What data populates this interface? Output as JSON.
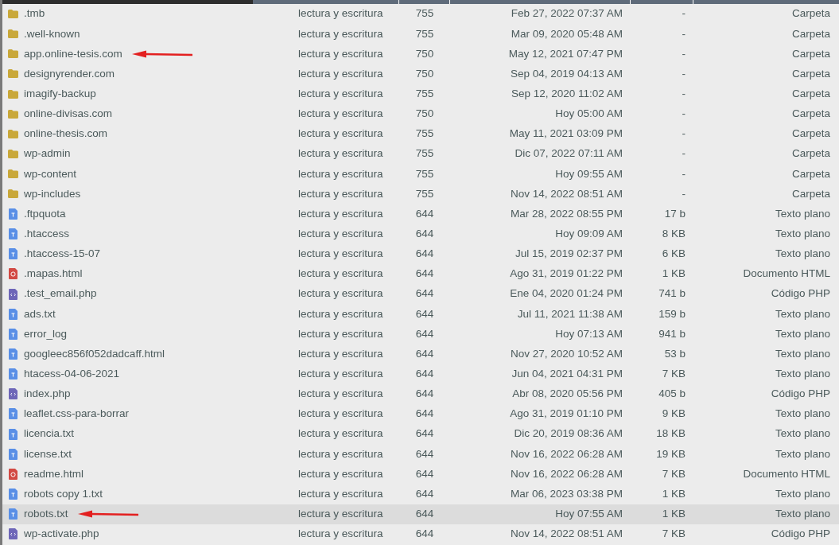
{
  "rows": [
    {
      "kind": "folder",
      "name": ".tmb",
      "permissions": "lectura y escritura",
      "mode": "755",
      "modified": "Feb 27, 2022 07:37 AM",
      "size": "-",
      "type": "Carpeta",
      "selected": false,
      "arrow": false
    },
    {
      "kind": "folder",
      "name": ".well-known",
      "permissions": "lectura y escritura",
      "mode": "755",
      "modified": "Mar 09, 2020 05:48 AM",
      "size": "-",
      "type": "Carpeta",
      "selected": false,
      "arrow": false
    },
    {
      "kind": "folder",
      "name": "app.online-tesis.com",
      "permissions": "lectura y escritura",
      "mode": "750",
      "modified": "May 12, 2021 07:47 PM",
      "size": "-",
      "type": "Carpeta",
      "selected": false,
      "arrow": true
    },
    {
      "kind": "folder",
      "name": "designyrender.com",
      "permissions": "lectura y escritura",
      "mode": "750",
      "modified": "Sep 04, 2019 04:13 AM",
      "size": "-",
      "type": "Carpeta",
      "selected": false,
      "arrow": false
    },
    {
      "kind": "folder",
      "name": "imagify-backup",
      "permissions": "lectura y escritura",
      "mode": "755",
      "modified": "Sep 12, 2020 11:02 AM",
      "size": "-",
      "type": "Carpeta",
      "selected": false,
      "arrow": false
    },
    {
      "kind": "folder",
      "name": "online-divisas.com",
      "permissions": "lectura y escritura",
      "mode": "750",
      "modified": "Hoy 05:00 AM",
      "size": "-",
      "type": "Carpeta",
      "selected": false,
      "arrow": false
    },
    {
      "kind": "folder",
      "name": "online-thesis.com",
      "permissions": "lectura y escritura",
      "mode": "755",
      "modified": "May 11, 2021 03:09 PM",
      "size": "-",
      "type": "Carpeta",
      "selected": false,
      "arrow": false
    },
    {
      "kind": "folder",
      "name": "wp-admin",
      "permissions": "lectura y escritura",
      "mode": "755",
      "modified": "Dic 07, 2022 07:11 AM",
      "size": "-",
      "type": "Carpeta",
      "selected": false,
      "arrow": false
    },
    {
      "kind": "folder",
      "name": "wp-content",
      "permissions": "lectura y escritura",
      "mode": "755",
      "modified": "Hoy 09:55 AM",
      "size": "-",
      "type": "Carpeta",
      "selected": false,
      "arrow": false
    },
    {
      "kind": "folder",
      "name": "wp-includes",
      "permissions": "lectura y escritura",
      "mode": "755",
      "modified": "Nov 14, 2022 08:51 AM",
      "size": "-",
      "type": "Carpeta",
      "selected": false,
      "arrow": false
    },
    {
      "kind": "text",
      "name": ".ftpquota",
      "permissions": "lectura y escritura",
      "mode": "644",
      "modified": "Mar 28, 2022 08:55 PM",
      "size": "17 b",
      "type": "Texto plano",
      "selected": false,
      "arrow": false
    },
    {
      "kind": "text",
      "name": ".htaccess",
      "permissions": "lectura y escritura",
      "mode": "644",
      "modified": "Hoy 09:09 AM",
      "size": "8 KB",
      "type": "Texto plano",
      "selected": false,
      "arrow": false
    },
    {
      "kind": "text",
      "name": ".htaccess-15-07",
      "permissions": "lectura y escritura",
      "mode": "644",
      "modified": "Jul 15, 2019 02:37 PM",
      "size": "6 KB",
      "type": "Texto plano",
      "selected": false,
      "arrow": false
    },
    {
      "kind": "html",
      "name": ".mapas.html",
      "permissions": "lectura y escritura",
      "mode": "644",
      "modified": "Ago 31, 2019 01:22 PM",
      "size": "1 KB",
      "type": "Documento HTML",
      "selected": false,
      "arrow": false
    },
    {
      "kind": "php",
      "name": ".test_email.php",
      "permissions": "lectura y escritura",
      "mode": "644",
      "modified": "Ene 04, 2020 01:24 PM",
      "size": "741 b",
      "type": "Código PHP",
      "selected": false,
      "arrow": false
    },
    {
      "kind": "text",
      "name": "ads.txt",
      "permissions": "lectura y escritura",
      "mode": "644",
      "modified": "Jul 11, 2021 11:38 AM",
      "size": "159 b",
      "type": "Texto plano",
      "selected": false,
      "arrow": false
    },
    {
      "kind": "text",
      "name": "error_log",
      "permissions": "lectura y escritura",
      "mode": "644",
      "modified": "Hoy 07:13 AM",
      "size": "941 b",
      "type": "Texto plano",
      "selected": false,
      "arrow": false
    },
    {
      "kind": "text",
      "name": "googleec856f052dadcaff.html",
      "permissions": "lectura y escritura",
      "mode": "644",
      "modified": "Nov 27, 2020 10:52 AM",
      "size": "53 b",
      "type": "Texto plano",
      "selected": false,
      "arrow": false
    },
    {
      "kind": "text",
      "name": "htacess-04-06-2021",
      "permissions": "lectura y escritura",
      "mode": "644",
      "modified": "Jun 04, 2021 04:31 PM",
      "size": "7 KB",
      "type": "Texto plano",
      "selected": false,
      "arrow": false
    },
    {
      "kind": "php",
      "name": "index.php",
      "permissions": "lectura y escritura",
      "mode": "644",
      "modified": "Abr 08, 2020 05:56 PM",
      "size": "405 b",
      "type": "Código PHP",
      "selected": false,
      "arrow": false
    },
    {
      "kind": "text",
      "name": "leaflet.css-para-borrar",
      "permissions": "lectura y escritura",
      "mode": "644",
      "modified": "Ago 31, 2019 01:10 PM",
      "size": "9 KB",
      "type": "Texto plano",
      "selected": false,
      "arrow": false
    },
    {
      "kind": "text",
      "name": "licencia.txt",
      "permissions": "lectura y escritura",
      "mode": "644",
      "modified": "Dic 20, 2019 08:36 AM",
      "size": "18 KB",
      "type": "Texto plano",
      "selected": false,
      "arrow": false
    },
    {
      "kind": "text",
      "name": "license.txt",
      "permissions": "lectura y escritura",
      "mode": "644",
      "modified": "Nov 16, 2022 06:28 AM",
      "size": "19 KB",
      "type": "Texto plano",
      "selected": false,
      "arrow": false
    },
    {
      "kind": "html",
      "name": "readme.html",
      "permissions": "lectura y escritura",
      "mode": "644",
      "modified": "Nov 16, 2022 06:28 AM",
      "size": "7 KB",
      "type": "Documento HTML",
      "selected": false,
      "arrow": false
    },
    {
      "kind": "text",
      "name": "robots copy 1.txt",
      "permissions": "lectura y escritura",
      "mode": "644",
      "modified": "Mar 06, 2023 03:38 PM",
      "size": "1 KB",
      "type": "Texto plano",
      "selected": false,
      "arrow": false
    },
    {
      "kind": "text",
      "name": "robots.txt",
      "permissions": "lectura y escritura",
      "mode": "644",
      "modified": "Hoy 07:55 AM",
      "size": "1 KB",
      "type": "Texto plano",
      "selected": true,
      "arrow": true
    },
    {
      "kind": "php",
      "name": "wp-activate.php",
      "permissions": "lectura y escritura",
      "mode": "644",
      "modified": "Nov 14, 2022 08:51 AM",
      "size": "7 KB",
      "type": "Código PHP",
      "selected": false,
      "arrow": false
    }
  ]
}
